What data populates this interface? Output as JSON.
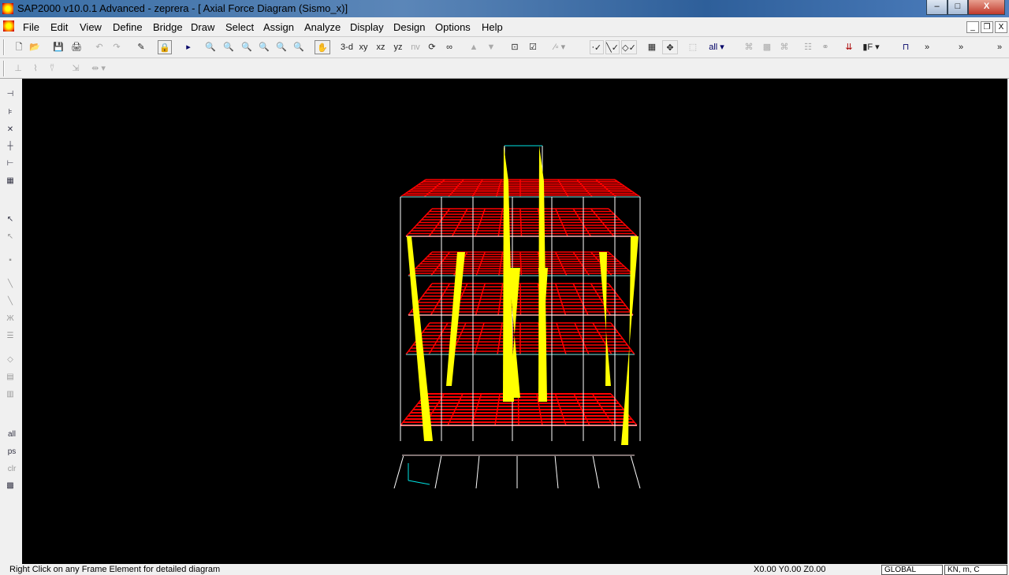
{
  "window": {
    "title": "SAP2000 v10.0.1  Advanced     - zeprera - [  Axial Force Diagram   (Sismo_x)]",
    "minimize": "–",
    "maximize": "□",
    "close": "X"
  },
  "menu": [
    "File",
    "Edit",
    "View",
    "Define",
    "Bridge",
    "Draw",
    "Select",
    "Assign",
    "Analyze",
    "Display",
    "Design",
    "Options",
    "Help"
  ],
  "toolbar": {
    "view_3d": "3-d",
    "view_xy": "xy",
    "view_xz": "xz",
    "view_yz": "yz",
    "view_nv": "nv"
  },
  "side_toolbar": {
    "all": "all",
    "ps": "ps",
    "clr": "clr"
  },
  "status": {
    "message": "Right Click on any Frame Element for detailed diagram",
    "coords": "X0.00  Y0.00  Z0.00",
    "coord_system": "GLOBAL",
    "units": "KN, m, C"
  },
  "colors": {
    "canvas": "#000000",
    "frames": "#ffffff",
    "beams_diagram": "#ff0000",
    "columns_diagram": "#ffff00",
    "cyan_frames": "#00e5e5"
  }
}
